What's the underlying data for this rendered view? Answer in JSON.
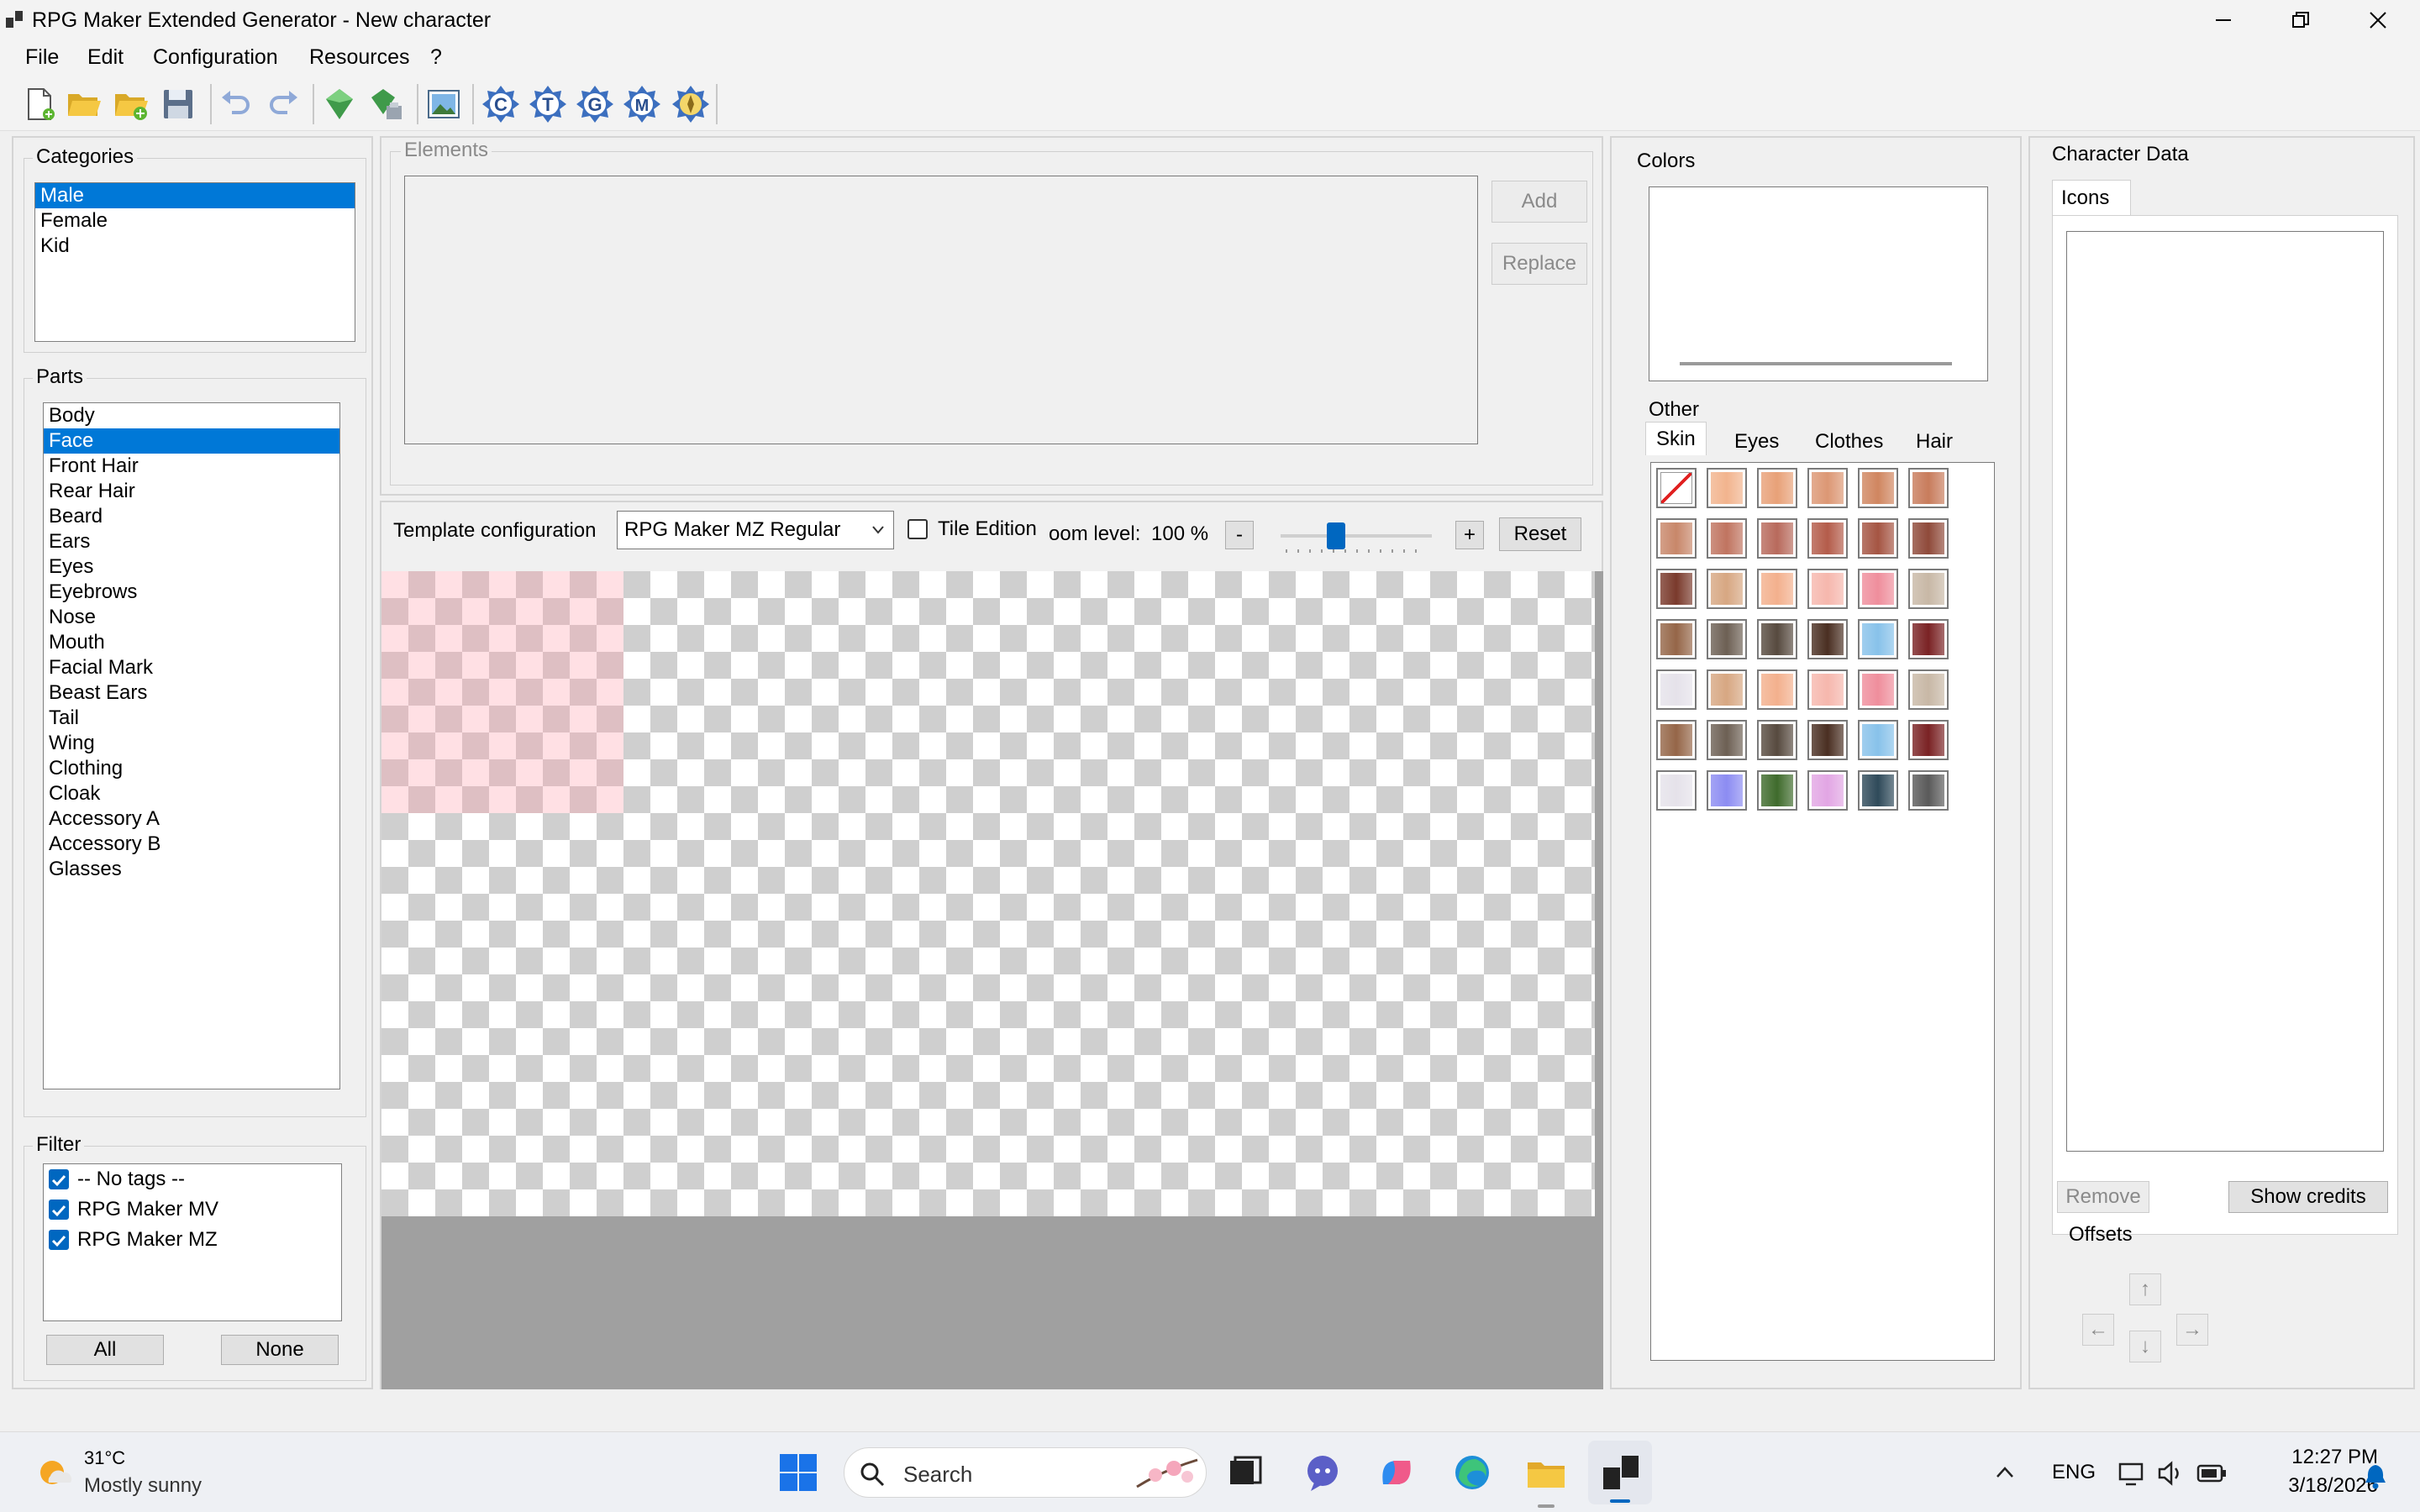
{
  "window": {
    "title": "RPG Maker Extended Generator - New character"
  },
  "menu": [
    "File",
    "Edit",
    "Configuration",
    "Resources",
    "?"
  ],
  "toolbar": {
    "icons": [
      "new-file-icon",
      "open-folder-icon",
      "open-folder-plus-icon",
      "save-icon",
      "undo-icon",
      "redo-icon",
      "green-gem-icon",
      "gem-export-icon",
      "image-icon",
      "c-icon",
      "t-icon",
      "g-icon",
      "m-icon",
      "compass-icon"
    ],
    "letters": {
      "c": "C",
      "t": "T",
      "g": "G",
      "m": "M"
    }
  },
  "categories": {
    "label": "Categories",
    "items": [
      "Male",
      "Female",
      "Kid"
    ],
    "selected": 0
  },
  "parts": {
    "label": "Parts",
    "items": [
      "Body",
      "Face",
      "Front Hair",
      "Rear Hair",
      "Beard",
      "Ears",
      "Eyes",
      "Eyebrows",
      "Nose",
      "Mouth",
      "Facial Mark",
      "Beast Ears",
      "Tail",
      "Wing",
      "Clothing",
      "Cloak",
      "Accessory A",
      "Accessory B",
      "Glasses"
    ],
    "selected": 1
  },
  "filter": {
    "label": "Filter",
    "items": [
      {
        "label": "-- No tags --",
        "checked": true
      },
      {
        "label": "RPG Maker MV",
        "checked": true
      },
      {
        "label": "RPG Maker MZ",
        "checked": true
      }
    ],
    "all_label": "All",
    "none_label": "None"
  },
  "elements": {
    "label": "Elements",
    "add_label": "Add",
    "replace_label": "Replace"
  },
  "template": {
    "label": "Template configuration",
    "selected": "RPG Maker MZ Regular",
    "tile_edition_label": "Tile Edition",
    "zoom_label": "oom level:",
    "zoom_value": "100 %",
    "minus_label": "-",
    "plus_label": "+",
    "reset_label": "Reset",
    "zoom_fraction": 0.35
  },
  "colors": {
    "label": "Colors",
    "other_label": "Other",
    "tabs": [
      "Skin",
      "Eyes",
      "Clothes",
      "Hair"
    ],
    "active_tab": 0,
    "swatches": [
      [
        "none",
        "#f2b48e",
        "#e8a178",
        "#dc9774",
        "#d08660",
        "#c87c5c"
      ],
      [
        "#c8876a",
        "#c07460",
        "#b86a5c",
        "#b45c4a",
        "#a55543",
        "#8f4a3a"
      ],
      [
        "#7a3a2c",
        "#d7a782",
        "#f3b08d",
        "#f6b7ad",
        "#ef8e9c",
        "#c8b8a6"
      ],
      [
        "#956648",
        "#6d6054",
        "#574a3f",
        "#4a2f22",
        "#88c2ea",
        "#7a2224"
      ],
      [
        "#e5e2ea",
        "#d7a782",
        "#f3b08d",
        "#f6b7ad",
        "#ef8e9c",
        "#c8b8a6"
      ],
      [
        "#956648",
        "#6d6054",
        "#574a3f",
        "#4a2f22",
        "#88c2ea",
        "#7a2224"
      ],
      [
        "#e5e2ea",
        "#8c8cf2",
        "#3f6b2c",
        "#e2a6e4",
        "#2f4a5a",
        "#5a5a5a"
      ]
    ]
  },
  "character": {
    "label": "Character Data",
    "tab": "Icons",
    "remove_label": "Remove",
    "credits_label": "Show credits",
    "offsets_label": "Offsets",
    "up": "↑",
    "down": "↓",
    "left": "←",
    "right": "→"
  },
  "taskbar": {
    "temperature": "31°C",
    "weather": "Mostly sunny",
    "search_placeholder": "Search",
    "language": "ENG",
    "time": "12:27 PM",
    "date": "3/18/2026"
  }
}
